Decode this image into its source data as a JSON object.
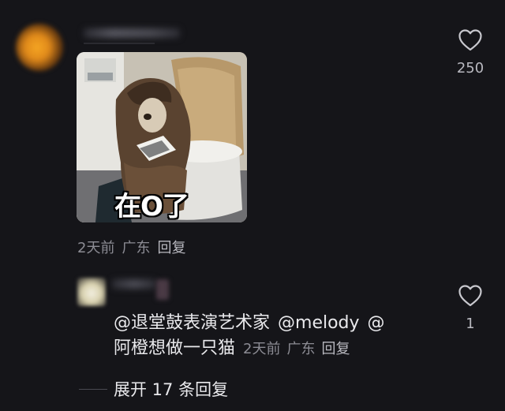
{
  "comment": {
    "sticker_caption": "在O了",
    "meta": {
      "time": "2天前",
      "location": "广东",
      "reply": "回复"
    },
    "likes": "250"
  },
  "reply": {
    "mentions": [
      "@退堂鼓表演艺术家",
      "@melody",
      "@"
    ],
    "text": "阿橙想做一只猫",
    "meta": {
      "time": "2天前",
      "location": "广东",
      "reply": "回复"
    },
    "likes": "1"
  },
  "expand": {
    "label": "展开 17 条回复"
  },
  "icons": {
    "like": "heart-outline-icon"
  },
  "colors": {
    "background": "#151519",
    "text": "#e9e9ec",
    "muted": "#8c8c94"
  }
}
